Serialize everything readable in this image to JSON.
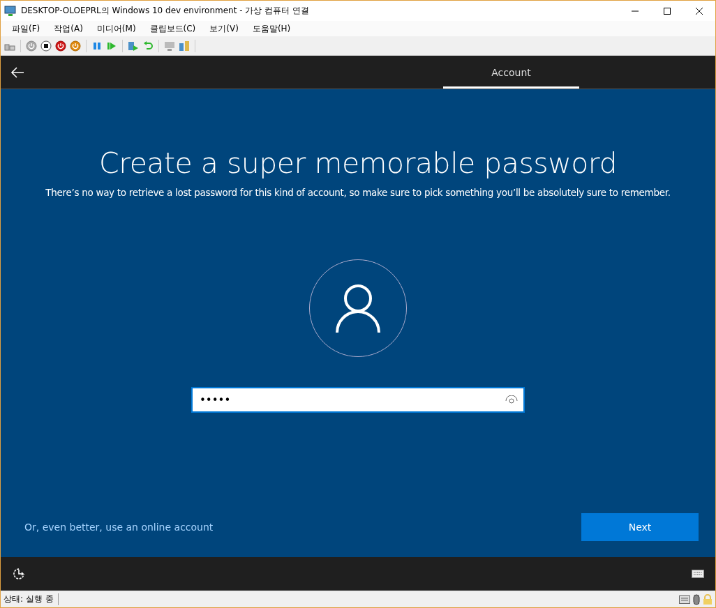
{
  "window": {
    "title": "DESKTOP-OLOEPRL의 Windows 10 dev environment - 가상 컴퓨터 연결"
  },
  "menu": [
    "파일(F)",
    "작업(A)",
    "미디어(M)",
    "클립보드(C)",
    "보기(V)",
    "도움말(H)"
  ],
  "header": {
    "tabs": [
      {
        "label": "Account",
        "selected": true
      }
    ]
  },
  "page": {
    "heading": "Create a super memorable password",
    "subtitle": "There’s no way to retrieve a lost password for this kind of account, so make sure to pick something you’ll be absolutely sure to remember.",
    "password": {
      "value": "•••••"
    },
    "link": "Or, even better, use an online account",
    "next_button": "Next"
  },
  "status_bar": {
    "text": "상태: 실행 중"
  }
}
